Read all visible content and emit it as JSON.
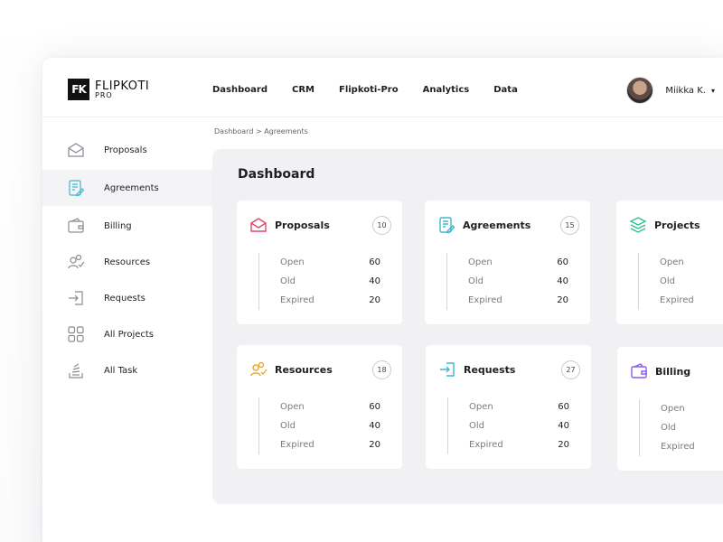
{
  "brand": {
    "name": "FLIPKOTI",
    "sub": "PRO",
    "mark": "FK"
  },
  "nav": [
    "Dashboard",
    "CRM",
    "Flipkoti-Pro",
    "Analytics",
    "Data"
  ],
  "user": {
    "name": "Miikka K.",
    "caret": "▾"
  },
  "sidebar": {
    "items": [
      {
        "label": "Proposals",
        "icon": "envelope-icon"
      },
      {
        "label": "Agreements",
        "icon": "document-edit-icon"
      },
      {
        "label": "Billing",
        "icon": "wallet-icon"
      },
      {
        "label": "Resources",
        "icon": "users-icon"
      },
      {
        "label": "Requests",
        "icon": "sign-in-icon"
      },
      {
        "label": "All Projects",
        "icon": "grid-icon"
      },
      {
        "label": "All Task",
        "icon": "stack-icon"
      }
    ]
  },
  "breadcrumb": "Dashboard > Agreements",
  "main": {
    "title": "Dashboard"
  },
  "cards": [
    {
      "title": "Proposals",
      "count": "10",
      "icon": "envelope-icon",
      "color": "#e0456b",
      "stats": [
        {
          "label": "Open",
          "value": "60"
        },
        {
          "label": "Old",
          "value": "40"
        },
        {
          "label": "Expired",
          "value": "20"
        }
      ]
    },
    {
      "title": "Agreements",
      "count": "15",
      "icon": "document-edit-icon",
      "color": "#3fb8c9",
      "stats": [
        {
          "label": "Open",
          "value": "60"
        },
        {
          "label": "Old",
          "value": "40"
        },
        {
          "label": "Expired",
          "value": "20"
        }
      ]
    },
    {
      "title": "Projects",
      "count": "",
      "icon": "layers-icon",
      "color": "#2fc28a",
      "stats": [
        {
          "label": "Open",
          "value": ""
        },
        {
          "label": "Old",
          "value": ""
        },
        {
          "label": "Expired",
          "value": ""
        }
      ]
    },
    {
      "title": "Resources",
      "count": "18",
      "icon": "users-icon",
      "color": "#f0a52a",
      "stats": [
        {
          "label": "Open",
          "value": "60"
        },
        {
          "label": "Old",
          "value": "40"
        },
        {
          "label": "Expired",
          "value": "20"
        }
      ]
    },
    {
      "title": "Requests",
      "count": "27",
      "icon": "sign-in-icon",
      "color": "#3fb8c9",
      "stats": [
        {
          "label": "Open",
          "value": "60"
        },
        {
          "label": "Old",
          "value": "40"
        },
        {
          "label": "Expired",
          "value": "20"
        }
      ]
    },
    {
      "title": "Billing",
      "count": "",
      "icon": "wallet-icon",
      "color": "#8a5cf0",
      "stats": [
        {
          "label": "Open",
          "value": ""
        },
        {
          "label": "Old",
          "value": ""
        },
        {
          "label": "Expired",
          "value": ""
        }
      ]
    }
  ]
}
